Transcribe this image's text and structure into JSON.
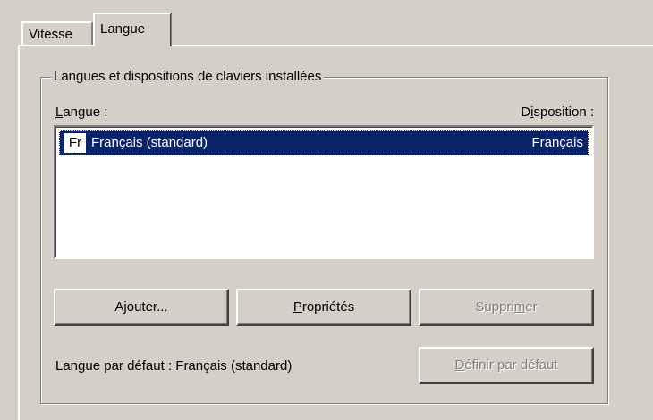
{
  "tabs": [
    {
      "label": "Vitesse",
      "active": false
    },
    {
      "label": "Langue",
      "active": true
    }
  ],
  "group": {
    "title": "Langues et dispositions de claviers installées",
    "col_langue_pre": "",
    "col_langue_key": "L",
    "col_langue_post": "angue :",
    "col_disposition_pre": "D",
    "col_disposition_key": "i",
    "col_disposition_post": "sposition :"
  },
  "list": {
    "items": [
      {
        "badge": "Fr",
        "language": "Français (standard)",
        "layout": "Français",
        "selected": true
      }
    ]
  },
  "buttons": {
    "ajouter_pre": "A",
    "ajouter_key": "j",
    "ajouter_post": "outer...",
    "proprietes_key": "P",
    "proprietes_post": "ropriétés",
    "supprimer_pre": "Suppri",
    "supprimer_key": "m",
    "supprimer_post": "er",
    "definir_key": "D",
    "definir_post": "éfinir par défaut"
  },
  "default_language_text": "Langue par défaut : Français (standard)",
  "colors": {
    "face": "#d4d0c8",
    "selection": "#0a246a",
    "disabled_text": "#808080"
  }
}
